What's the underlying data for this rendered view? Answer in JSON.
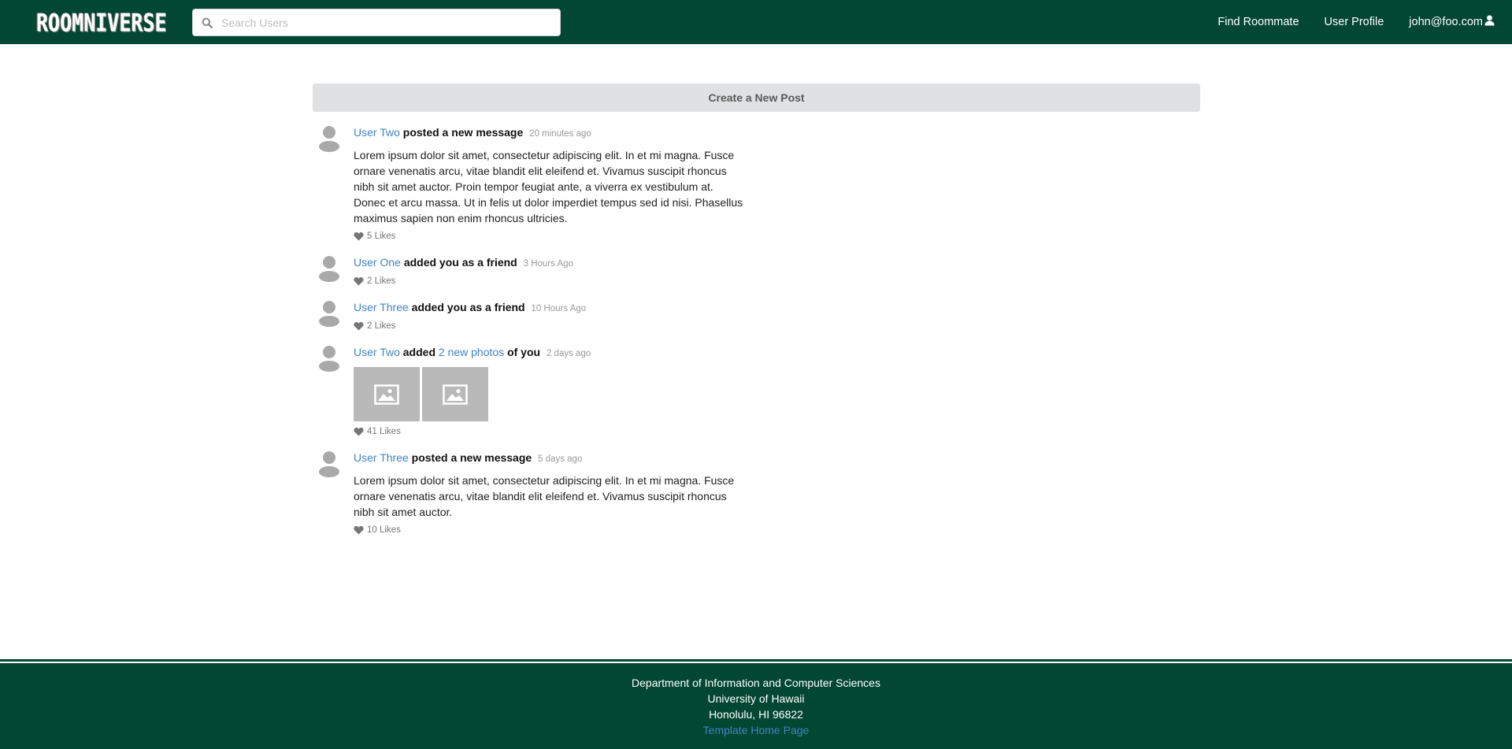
{
  "navbar": {
    "logo_text": "ROOMNIVERSE",
    "search": {
      "placeholder": "Search Users",
      "value": ""
    },
    "links": [
      "Find Roommate",
      "User Profile",
      "john@foo.com"
    ]
  },
  "main": {
    "create_post_label": "Create a New Post",
    "feed": [
      {
        "user": "User Two",
        "action": "posted a new message",
        "date": "20 minutes ago",
        "text": "Lorem ipsum dolor sit amet, consectetur adipiscing elit. In et mi magna. Fusce ornare venenatis arcu, vitae blandit elit eleifend et. Vivamus suscipit rhoncus nibh sit amet auctor. Proin tempor feugiat ante, a viverra ex vestibulum at. Donec et arcu massa. Ut in felis ut dolor imperdiet tempus sed id nisi. Phasellus maximus sapien non enim rhoncus ultricies.",
        "likes": "5 Likes"
      },
      {
        "user": "User One",
        "action": "added you as a friend",
        "date": "3 Hours Ago",
        "likes": "2 Likes"
      },
      {
        "user": "User Three",
        "action": "added you as a friend",
        "date": "10 Hours Ago",
        "likes": "2 Likes"
      },
      {
        "user": "User Two",
        "action_pre": "added",
        "action_link": "2 new photos",
        "action_post": "of you",
        "date": "2 days ago",
        "likes": "41 Likes"
      },
      {
        "user": "User Three",
        "action": "posted a new message",
        "date": "5 days ago",
        "text": "Lorem ipsum dolor sit amet, consectetur adipiscing elit. In et mi magna. Fusce ornare venenatis arcu, vitae blandit elit eleifend et. Vivamus suscipit rhoncus nibh sit amet auctor.",
        "likes": "10 Likes"
      }
    ]
  },
  "footer": {
    "line1": "Department of Information and Computer Sciences",
    "line2": "University of Hawaii",
    "line3": "Honolulu, HI 96822",
    "link": "Template Home Page"
  },
  "colors": {
    "navbar": "#024731",
    "link": "#4183c4",
    "button_bg": "#e0e1e2"
  },
  "icons": {
    "search": "search-icon",
    "user": "user-icon",
    "avatar": "avatar-icon",
    "heart": "heart-icon",
    "image": "image-icon"
  }
}
